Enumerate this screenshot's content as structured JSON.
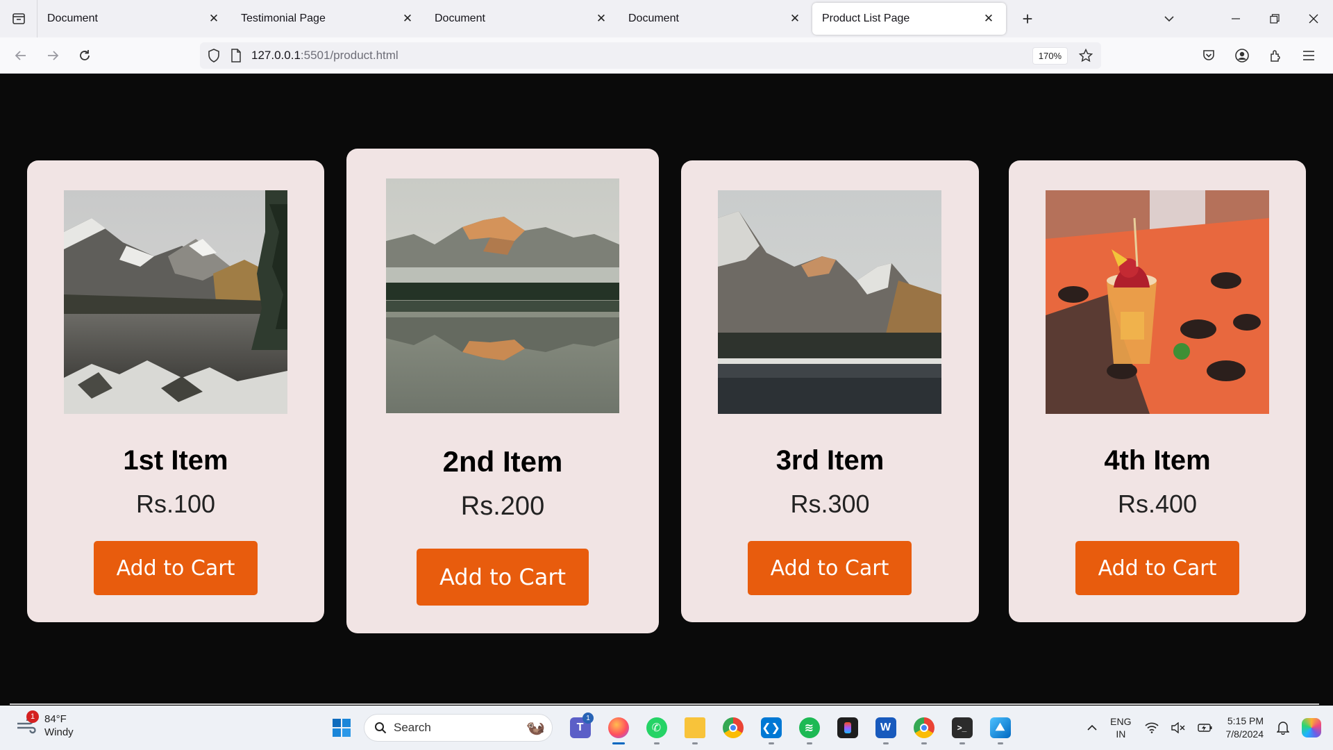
{
  "browser": {
    "tabs": [
      {
        "title": "Document",
        "close": "✕"
      },
      {
        "title": "Testimonial Page",
        "close": "✕"
      },
      {
        "title": "Document",
        "close": "✕"
      },
      {
        "title": "Document",
        "close": "✕"
      },
      {
        "title": "Product List Page",
        "close": "✕",
        "active": true
      }
    ],
    "new_tab": "+",
    "url_host": "127.0.0.1",
    "url_rest": ":5501/product.html",
    "zoom": "170%"
  },
  "products": [
    {
      "name": "1st Item",
      "price": "Rs.100",
      "button": "Add to Cart"
    },
    {
      "name": "2nd Item",
      "price": "Rs.200",
      "button": "Add to Cart"
    },
    {
      "name": "3rd Item",
      "price": "Rs.300",
      "button": "Add to Cart"
    },
    {
      "name": "4th Item",
      "price": "Rs.400",
      "button": "Add to Cart"
    }
  ],
  "taskbar": {
    "weather_temp": "84°F",
    "weather_desc": "Windy",
    "weather_badge": "1",
    "search_label": "Search",
    "lang_line1": "ENG",
    "lang_line2": "IN",
    "time": "5:15 PM",
    "date": "7/8/2024",
    "teams_badge": "1"
  },
  "colors": {
    "page_bg": "#0a0a0a",
    "card_bg": "#f1e4e4",
    "button_bg": "#e85c0d",
    "button_text": "#ffffff"
  }
}
